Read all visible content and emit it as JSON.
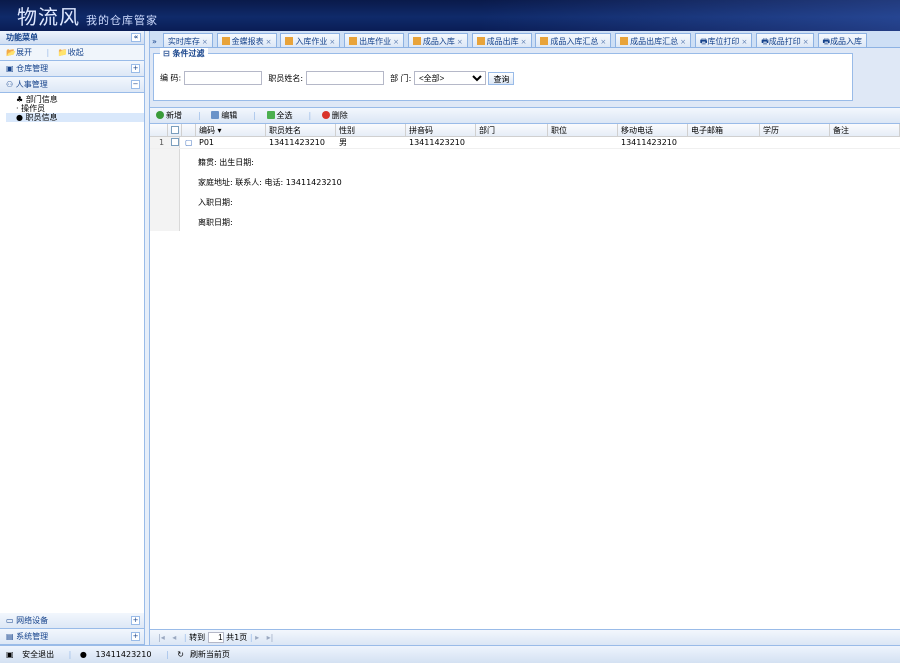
{
  "banner": {
    "title": "物流风",
    "subtitle": "我的仓库管家"
  },
  "sidebar": {
    "header": "功能菜单",
    "toolbar": [
      "展开",
      "收起"
    ],
    "groups": [
      {
        "label": "仓库管理",
        "toggle": "+"
      },
      {
        "label": "人事管理",
        "toggle": "−"
      }
    ],
    "tree": [
      "部门信息",
      "操作员",
      "职员信息"
    ],
    "bottom_groups": [
      {
        "label": "网络设备",
        "toggle": "+"
      },
      {
        "label": "系统管理",
        "toggle": "+"
      }
    ]
  },
  "tabs": [
    "实时库存",
    "金蝶报表",
    "入库作业",
    "出库作业",
    "成品入库",
    "成品出库",
    "成品入库汇总",
    "成品出库汇总",
    "库位打印",
    "成品打印",
    "成品入库"
  ],
  "filter": {
    "title": "条件过滤",
    "field1_label": "编 码:",
    "field2_label": "职员姓名:",
    "field3_label": "部 门:",
    "select_value": "<全部>",
    "button": "查询"
  },
  "grid": {
    "toolbar": [
      "新增",
      "编辑",
      "全选",
      "删除"
    ],
    "columns": [
      "编码",
      "职员姓名",
      "性别",
      "拼音码",
      "部门",
      "职位",
      "移动电话",
      "电子邮箱",
      "学历",
      "备注"
    ],
    "rows": [
      {
        "num": "1",
        "code": "P01",
        "name": "13411423210",
        "gender": "男",
        "pinyin": "13411423210",
        "dept": "",
        "position": "",
        "mobile": "13411423210",
        "email": "",
        "edu": "",
        "note": ""
      }
    ],
    "detail": {
      "line1": "籍贯:   出生日期:",
      "line2": "家庭地址:   联系人:   电话: 13411423210",
      "line3": "入职日期:",
      "line4": "离职日期:"
    }
  },
  "pager": {
    "goto": "转到",
    "page": "1",
    "total": "共1页"
  },
  "status": {
    "security": "安全退出",
    "user": "13411423210",
    "refresh": "刷新当前页"
  }
}
